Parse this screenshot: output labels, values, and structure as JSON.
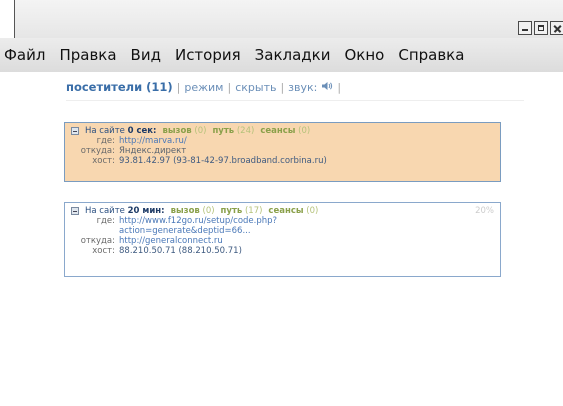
{
  "window": {
    "controls": [
      "minimize",
      "maximize",
      "close"
    ]
  },
  "menu": {
    "items": [
      "Файл",
      "Правка",
      "Вид",
      "История",
      "Закладки",
      "Окно",
      "Справка"
    ]
  },
  "header": {
    "title": "посетители (11)",
    "sep": "|",
    "mode": "режим",
    "hide": "скрыть",
    "sound": "звук:",
    "sound_icon": "speaker-icon"
  },
  "visitors": [
    {
      "status": "active",
      "bg": "#f8d7b0",
      "label": "На сайте",
      "time": "0 сек:",
      "calls_label": "вызов",
      "calls": "(0)",
      "paths_label": "путь",
      "paths": "(24)",
      "sessions_label": "сеансы",
      "sessions": "(0)",
      "where_key": "где:",
      "where": "http://marva.ru/",
      "from_key": "откуда:",
      "from": "Яндекс.директ",
      "host_key": "хост:",
      "host": "93.81.42.97 (93-81-42-97.broadband.corbina.ru)"
    },
    {
      "status": "inactive",
      "bg": "#ffffff",
      "label": "На сайте",
      "time": "20 мин:",
      "calls_label": "вызов",
      "calls": "(0)",
      "paths_label": "путь",
      "paths": "(17)",
      "sessions_label": "сеансы",
      "sessions": "(0)",
      "percent": "20%",
      "where_key": "где:",
      "where": "http://www.f12go.ru/setup/code.php?",
      "where_cont": "action=generate&deptid=66...",
      "from_key": "откуда:",
      "from": "http://generalconnect.ru",
      "host_key": "хост:",
      "host": "88.210.50.71 (88.210.50.71)"
    }
  ]
}
